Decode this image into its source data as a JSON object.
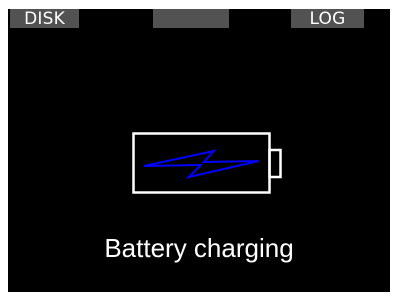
{
  "softkeys": {
    "left_label": "DISK",
    "center_label": "",
    "right_label": "LOG"
  },
  "status": {
    "message": "Battery charging",
    "icon": "battery-charging-icon"
  },
  "colors": {
    "screen_background": "#000000",
    "softkey_background": "#525252",
    "text": "#ffffff",
    "battery_outline": "#ffffff",
    "bolt": "#0000ff"
  }
}
